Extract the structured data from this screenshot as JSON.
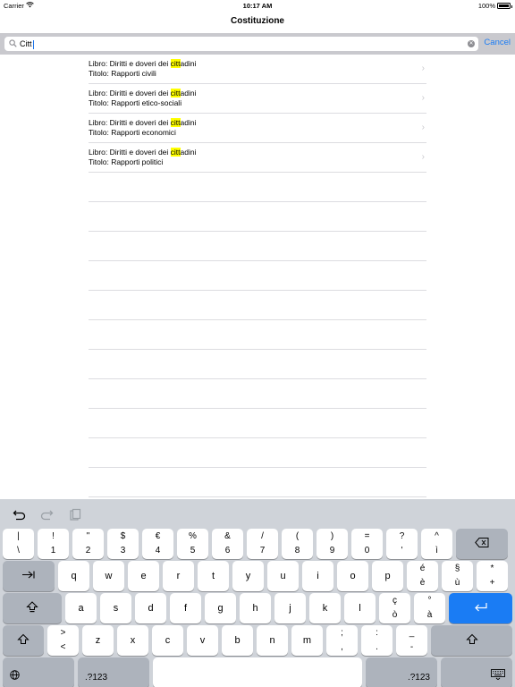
{
  "status": {
    "carrier": "Carrier",
    "time": "10:17 AM",
    "battery": "100%"
  },
  "nav": {
    "title": "Costituzione"
  },
  "search": {
    "query": "Citt",
    "cancel": "Cancel"
  },
  "results": [
    {
      "book_prefix": "Libro: Diritti e doveri dei ",
      "match": "citt",
      "book_suffix": "adini",
      "title": "Titolo: Rapporti civili"
    },
    {
      "book_prefix": "Libro: Diritti e doveri dei ",
      "match": "citt",
      "book_suffix": "adini",
      "title": "Titolo: Rapporti etico-sociali"
    },
    {
      "book_prefix": "Libro: Diritti e doveri dei ",
      "match": "citt",
      "book_suffix": "adini",
      "title": "Titolo: Rapporti economici"
    },
    {
      "book_prefix": "Libro: Diritti e doveri dei ",
      "match": "citt",
      "book_suffix": "adini",
      "title": "Titolo: Rapporti politici"
    }
  ],
  "keyboard": {
    "number_row": [
      {
        "top": "|",
        "bottom": "\\"
      },
      {
        "top": "!",
        "bottom": "1"
      },
      {
        "top": "\"",
        "bottom": "2"
      },
      {
        "top": "$",
        "bottom": "3"
      },
      {
        "top": "€",
        "bottom": "4"
      },
      {
        "top": "%",
        "bottom": "5"
      },
      {
        "top": "&",
        "bottom": "6"
      },
      {
        "top": "/",
        "bottom": "7"
      },
      {
        "top": "(",
        "bottom": "8"
      },
      {
        "top": ")",
        "bottom": "9"
      },
      {
        "top": "=",
        "bottom": "0"
      },
      {
        "top": "?",
        "bottom": "'"
      },
      {
        "top": "^",
        "bottom": "ì"
      }
    ],
    "row_q": [
      "q",
      "w",
      "e",
      "r",
      "t",
      "y",
      "u",
      "i",
      "o",
      "p"
    ],
    "row_q_extra": [
      {
        "top": "é",
        "bottom": "è"
      },
      {
        "top": "§",
        "bottom": "ù"
      },
      {
        "top": "*",
        "bottom": "+"
      }
    ],
    "row_a": [
      "a",
      "s",
      "d",
      "f",
      "g",
      "h",
      "j",
      "k",
      "l"
    ],
    "row_a_extra": [
      {
        "top": "ç",
        "bottom": "ò"
      },
      {
        "top": "°",
        "bottom": "à"
      }
    ],
    "row_z_first": {
      "top": ">",
      "bottom": "<"
    },
    "row_z": [
      "z",
      "x",
      "c",
      "v",
      "b",
      "n",
      "m"
    ],
    "row_z_extra": [
      {
        "top": ";",
        "bottom": ","
      },
      {
        "top": ":",
        "bottom": "."
      },
      {
        "top": "_",
        "bottom": "-"
      }
    ],
    "numbers_label": ".?123"
  }
}
